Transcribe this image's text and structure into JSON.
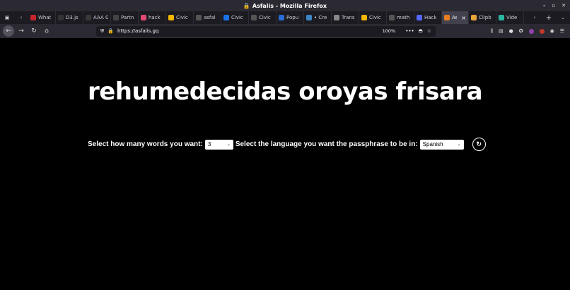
{
  "window": {
    "title": "Asfalis - Mozilla Firefox",
    "controls": [
      "–",
      "▫",
      "✕"
    ]
  },
  "tabs": [
    {
      "label": "What",
      "color": "#c4252b"
    },
    {
      "label": "D3.js",
      "color": "#333333"
    },
    {
      "label": "AAA Ga",
      "color": "#3a3a3a"
    },
    {
      "label": "Partn",
      "color": "#444444"
    },
    {
      "label": "hack",
      "color": "#e04a72"
    },
    {
      "label": "Civic",
      "color": "#f5b800"
    },
    {
      "label": "asfal",
      "color": "#555555"
    },
    {
      "label": "Civic",
      "color": "#1a73e8"
    },
    {
      "label": "Civic",
      "color": "#555555"
    },
    {
      "label": "Popu",
      "color": "#2a6cd6"
    },
    {
      "label": "• Cre",
      "color": "#3d85c6"
    },
    {
      "label": "Trans",
      "color": "#888888"
    },
    {
      "label": "Civic",
      "color": "#f5b800"
    },
    {
      "label": "math",
      "color": "#555555"
    },
    {
      "label": "Hack",
      "color": "#5468ff"
    },
    {
      "label": "As",
      "color": "#e67e22",
      "active": true
    },
    {
      "label": "Clipb",
      "color": "#e8a33d"
    },
    {
      "label": "Vide",
      "color": "#2bb7a1"
    }
  ],
  "nav": {
    "url": "https://asfalis.gq",
    "zoom": "100%"
  },
  "page": {
    "passphrase": "rehumedecidas oroyas frisara",
    "words_label": "Select how many words you want:",
    "words_value": "3",
    "language_label": "Select the language you want the passphrase to be in:",
    "language_value": "Spanish"
  }
}
